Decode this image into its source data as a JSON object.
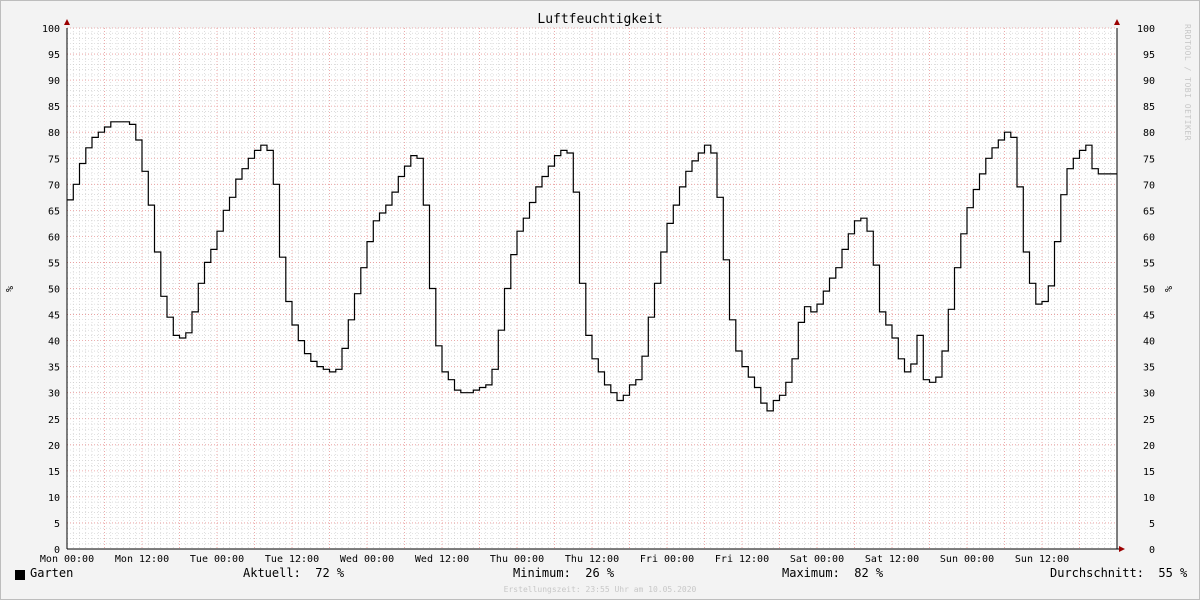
{
  "chart_data": {
    "type": "line",
    "title": "Luftfeuchtigkeit",
    "ylabel": "%",
    "ylim": [
      0,
      100
    ],
    "y_ticks": [
      0,
      5,
      10,
      15,
      20,
      25,
      30,
      35,
      40,
      45,
      50,
      55,
      60,
      65,
      70,
      75,
      80,
      85,
      90,
      95,
      100
    ],
    "xlim_hours": [
      0,
      168
    ],
    "x_ticks": [
      {
        "hour": 0,
        "label": "Mon 00:00"
      },
      {
        "hour": 12,
        "label": "Mon 12:00"
      },
      {
        "hour": 24,
        "label": "Tue 00:00"
      },
      {
        "hour": 36,
        "label": "Tue 12:00"
      },
      {
        "hour": 48,
        "label": "Wed 00:00"
      },
      {
        "hour": 60,
        "label": "Wed 12:00"
      },
      {
        "hour": 72,
        "label": "Thu 00:00"
      },
      {
        "hour": 84,
        "label": "Thu 12:00"
      },
      {
        "hour": 96,
        "label": "Fri 00:00"
      },
      {
        "hour": 108,
        "label": "Fri 12:00"
      },
      {
        "hour": 120,
        "label": "Sat 00:00"
      },
      {
        "hour": 132,
        "label": "Sat 12:00"
      },
      {
        "hour": 144,
        "label": "Sun 00:00"
      },
      {
        "hour": 156,
        "label": "Sun 12:00"
      }
    ],
    "grid": true,
    "colors": {
      "line": "#000000",
      "grid_minor": "#c8c8c8",
      "grid_major": "#e89595",
      "axis_arrow": "#9b0000",
      "background": "#ffffff",
      "canvas": "#f3f3f3"
    },
    "series": [
      {
        "name": "Garten",
        "points": [
          [
            0,
            67
          ],
          [
            1,
            70
          ],
          [
            2,
            74
          ],
          [
            3,
            77
          ],
          [
            4,
            79
          ],
          [
            5,
            80
          ],
          [
            6,
            81
          ],
          [
            7,
            82
          ],
          [
            8,
            82
          ],
          [
            9,
            82
          ],
          [
            10,
            81.5
          ],
          [
            11,
            78.5
          ],
          [
            12,
            72.5
          ],
          [
            13,
            66
          ],
          [
            14,
            57
          ],
          [
            15,
            48.5
          ],
          [
            16,
            44.5
          ],
          [
            17,
            41
          ],
          [
            18,
            40.5
          ],
          [
            19,
            41.5
          ],
          [
            20,
            45.5
          ],
          [
            21,
            51
          ],
          [
            22,
            55
          ],
          [
            23,
            57.5
          ],
          [
            24,
            61
          ],
          [
            25,
            65
          ],
          [
            26,
            67.5
          ],
          [
            27,
            71
          ],
          [
            28,
            73
          ],
          [
            29,
            75
          ],
          [
            30,
            76.5
          ],
          [
            31,
            77.5
          ],
          [
            32,
            76.5
          ],
          [
            33,
            70
          ],
          [
            34,
            56
          ],
          [
            35,
            47.5
          ],
          [
            36,
            43
          ],
          [
            37,
            40
          ],
          [
            38,
            37.5
          ],
          [
            39,
            36
          ],
          [
            40,
            35
          ],
          [
            41,
            34.5
          ],
          [
            42,
            34
          ],
          [
            43,
            34.5
          ],
          [
            44,
            38.5
          ],
          [
            45,
            44
          ],
          [
            46,
            49
          ],
          [
            47,
            54
          ],
          [
            48,
            59
          ],
          [
            49,
            63
          ],
          [
            50,
            64.5
          ],
          [
            51,
            66
          ],
          [
            52,
            68.5
          ],
          [
            53,
            71.5
          ],
          [
            54,
            73.5
          ],
          [
            55,
            75.5
          ],
          [
            56,
            75
          ],
          [
            57,
            66
          ],
          [
            58,
            50
          ],
          [
            59,
            39
          ],
          [
            60,
            34
          ],
          [
            61,
            32.5
          ],
          [
            62,
            30.5
          ],
          [
            63,
            30
          ],
          [
            64,
            30
          ],
          [
            65,
            30.5
          ],
          [
            66,
            31
          ],
          [
            67,
            31.5
          ],
          [
            68,
            34.5
          ],
          [
            69,
            42
          ],
          [
            70,
            50
          ],
          [
            71,
            56.5
          ],
          [
            72,
            61
          ],
          [
            73,
            63.5
          ],
          [
            74,
            66.5
          ],
          [
            75,
            69.5
          ],
          [
            76,
            71.5
          ],
          [
            77,
            73.5
          ],
          [
            78,
            75.5
          ],
          [
            79,
            76.5
          ],
          [
            80,
            76
          ],
          [
            81,
            68.5
          ],
          [
            82,
            51
          ],
          [
            83,
            41
          ],
          [
            84,
            36.5
          ],
          [
            85,
            34
          ],
          [
            86,
            31.5
          ],
          [
            87,
            30
          ],
          [
            88,
            28.5
          ],
          [
            89,
            29.5
          ],
          [
            90,
            31.5
          ],
          [
            91,
            32.5
          ],
          [
            92,
            37
          ],
          [
            93,
            44.5
          ],
          [
            94,
            51
          ],
          [
            95,
            57
          ],
          [
            96,
            62.5
          ],
          [
            97,
            66
          ],
          [
            98,
            69.5
          ],
          [
            99,
            72.5
          ],
          [
            100,
            74.5
          ],
          [
            101,
            76
          ],
          [
            102,
            77.5
          ],
          [
            103,
            76
          ],
          [
            104,
            67.5
          ],
          [
            105,
            55.5
          ],
          [
            106,
            44
          ],
          [
            107,
            38
          ],
          [
            108,
            35
          ],
          [
            109,
            33
          ],
          [
            110,
            31
          ],
          [
            111,
            28
          ],
          [
            112,
            26.5
          ],
          [
            113,
            28.5
          ],
          [
            114,
            29.5
          ],
          [
            115,
            32
          ],
          [
            116,
            36.5
          ],
          [
            117,
            43.5
          ],
          [
            118,
            46.5
          ],
          [
            119,
            45.5
          ],
          [
            120,
            47
          ],
          [
            121,
            49.5
          ],
          [
            122,
            52
          ],
          [
            123,
            54
          ],
          [
            124,
            57.5
          ],
          [
            125,
            60.5
          ],
          [
            126,
            63
          ],
          [
            127,
            63.5
          ],
          [
            128,
            61
          ],
          [
            129,
            54.5
          ],
          [
            130,
            45.5
          ],
          [
            131,
            43
          ],
          [
            132,
            40.5
          ],
          [
            133,
            36.5
          ],
          [
            134,
            34
          ],
          [
            135,
            35.5
          ],
          [
            136,
            41
          ],
          [
            137,
            32.5
          ],
          [
            138,
            32
          ],
          [
            139,
            33
          ],
          [
            140,
            38
          ],
          [
            141,
            46
          ],
          [
            142,
            54
          ],
          [
            143,
            60.5
          ],
          [
            144,
            65.5
          ],
          [
            145,
            69
          ],
          [
            146,
            72
          ],
          [
            147,
            75
          ],
          [
            148,
            77
          ],
          [
            149,
            78.5
          ],
          [
            150,
            80
          ],
          [
            151,
            79
          ],
          [
            152,
            69.5
          ],
          [
            153,
            57
          ],
          [
            154,
            51
          ],
          [
            155,
            47
          ],
          [
            156,
            47.5
          ],
          [
            157,
            50.5
          ],
          [
            158,
            59
          ],
          [
            159,
            68
          ],
          [
            160,
            73
          ],
          [
            161,
            75
          ],
          [
            162,
            76.5
          ],
          [
            163,
            77.5
          ],
          [
            164,
            73
          ],
          [
            165,
            72
          ],
          [
            166,
            72
          ],
          [
            167,
            72
          ]
        ]
      }
    ]
  },
  "legend": {
    "series_name": "Garten",
    "current_label": "Aktuell:",
    "current_value": "72 %",
    "min_label": "Minimum:",
    "min_value": "26 %",
    "max_label": "Maximum:",
    "max_value": "82 %",
    "avg_label": "Durchschnitt:",
    "avg_value": "55 %"
  },
  "footer": "Erstellungszeit: 23:55 Uhr am 10.05.2020",
  "watermark": "RRDTOOL / TOBI OETIKER"
}
